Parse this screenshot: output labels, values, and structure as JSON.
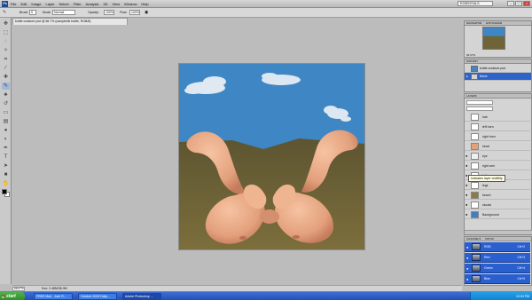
{
  "app": {
    "logo": "Ps",
    "workspace": "ESSENTIALS"
  },
  "menus": [
    "File",
    "Edit",
    "Image",
    "Layer",
    "Select",
    "Filter",
    "Analysis",
    "3D",
    "View",
    "Window",
    "Help"
  ],
  "options_bar": {
    "brush_label": "Brush:",
    "brush_size": "9",
    "mode_label": "Mode:",
    "mode_value": "Normal",
    "opacity_label": "Opacity:",
    "opacity_value": "100%",
    "flow_label": "Flow:",
    "flow_value": "100%"
  },
  "document": {
    "tab_title": "bottle creature psd @ 66.7% (campbells bottle, RGB/8)",
    "zoom": "66.67%",
    "info": "Doc: 2.48M/36.3M"
  },
  "panels": {
    "navigator_tabs": [
      "NAVIGATOR",
      "HISTOGRAM"
    ],
    "navigator_zoom": "66.67%",
    "history_tab": "HISTORY",
    "history_items": [
      {
        "label": "bottle creature.psd",
        "selected": false
      },
      {
        "label": "Move",
        "selected": true
      }
    ],
    "layers_tab": "LAYERS",
    "layers": [
      {
        "name": "hair",
        "visible": false,
        "thumb": "#ffffff"
      },
      {
        "name": "left horn",
        "visible": false,
        "thumb": "#ffffff"
      },
      {
        "name": "right horn",
        "visible": false,
        "thumb": "#ffffff"
      },
      {
        "name": "head",
        "visible": false,
        "thumb": "#e7a17a"
      },
      {
        "name": "eye",
        "visible": true,
        "thumb": "#f0f0f0"
      },
      {
        "name": "right arm",
        "visible": true,
        "thumb": "#ffffff"
      },
      {
        "name": "left arm",
        "visible": true,
        "thumb": "#ffffff"
      },
      {
        "name": "legs",
        "visible": true,
        "thumb": "#ffffff"
      },
      {
        "name": "beach",
        "visible": true,
        "thumb": "#8f7a42"
      },
      {
        "name": "clouds",
        "visible": true,
        "thumb": "#ffffff"
      },
      {
        "name": "Background",
        "visible": true,
        "thumb": "#3e7fc3"
      }
    ],
    "tooltip": "Indicates layer visibility",
    "channels_tabs": [
      "CHANNELS",
      "PATHS"
    ],
    "channels": [
      {
        "name": "RGB",
        "shortcut": "Ctrl+2"
      },
      {
        "name": "Red",
        "shortcut": "Ctrl+3"
      },
      {
        "name": "Green",
        "shortcut": "Ctrl+4"
      },
      {
        "name": "Blue",
        "shortcut": "Ctrl+5"
      }
    ]
  },
  "taskbar": {
    "start": "start",
    "tasks": [
      {
        "label": "FREE Mail - Josh R...",
        "active": false
      },
      {
        "label": "October 2009 Daily...",
        "active": false
      },
      {
        "label": "Adobe Photoshop ...",
        "active": true
      }
    ],
    "clock": "10:04 PM"
  },
  "colors": {
    "sky": "#3f86c5",
    "sand": "#6f6437",
    "skin": "#e7a17a",
    "selection": "#2e64c9"
  }
}
